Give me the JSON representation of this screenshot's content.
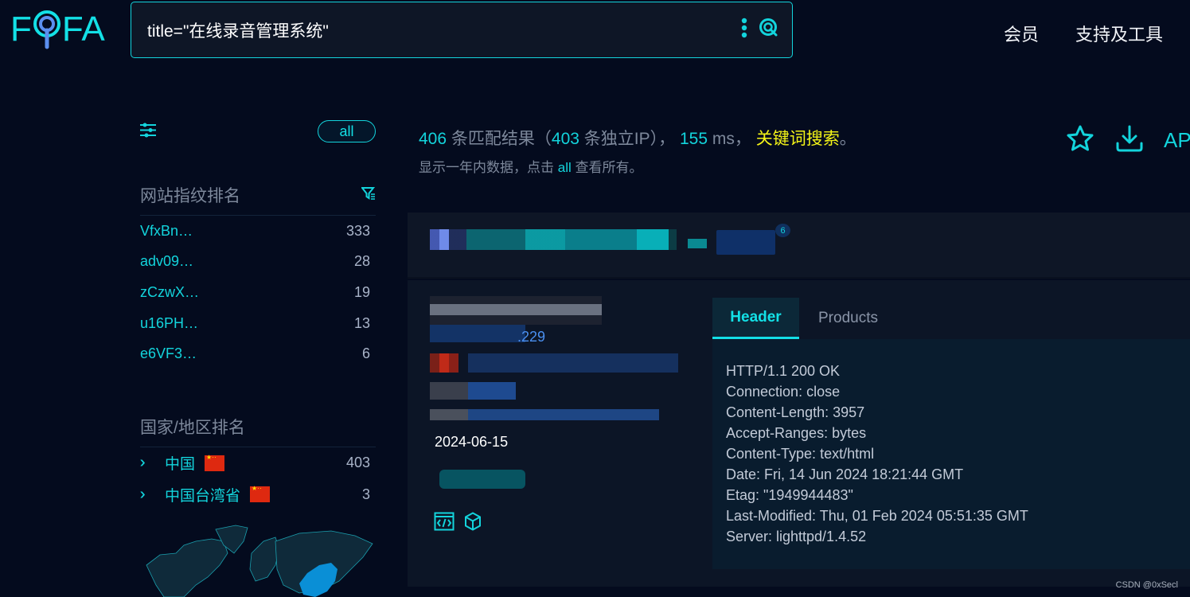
{
  "app": {
    "logo_text_left": "F",
    "logo_text_right": "FA",
    "brand_color": "#13e0e6",
    "keyword_color": "#f5f517"
  },
  "search": {
    "query": "title=\"在线录音管理系统\"",
    "more_icon": "vertical-dots-icon",
    "search_icon": "search-icon"
  },
  "nav": {
    "items": [
      {
        "label": "会员"
      },
      {
        "label": "支持及工具"
      }
    ]
  },
  "sidebar": {
    "settings_icon": "sliders-icon",
    "all_label": "all",
    "fingerprint_title": "网站指纹排名",
    "fingerprint_filter_icon": "filter-icon",
    "fingerprints": [
      {
        "name": "VfxBn…",
        "count": "333"
      },
      {
        "name": "adv09…",
        "count": "28"
      },
      {
        "name": "zCzwX…",
        "count": "19"
      },
      {
        "name": "u16PH…",
        "count": "13"
      },
      {
        "name": "e6VF3…",
        "count": "6"
      }
    ],
    "country_title": "国家/地区排名",
    "countries": [
      {
        "name": "中国",
        "count": "403",
        "flag": "cn-flag"
      },
      {
        "name": "中国台湾省",
        "count": "3",
        "flag": "cn-flag"
      }
    ],
    "map_highlight": "China"
  },
  "summary": {
    "total": "406",
    "total_label": "条匹配结果（",
    "unique_ip": "403",
    "unique_ip_label": "条独立IP），",
    "time": "155",
    "time_unit": "ms，",
    "keyword_search": "关键词搜索",
    "period": "。",
    "note_prefix": "显示一年内数据，点击",
    "note_link": "all",
    "note_suffix": "查看所有。"
  },
  "actions": {
    "star_icon": "star-icon",
    "download_icon": "download-icon",
    "api_label": "API"
  },
  "result": {
    "badge_count": "6",
    "ip_suffix": ".229",
    "date": "2024-06-15",
    "icons": [
      "code-window-icon",
      "cube-icon"
    ],
    "tabs": [
      {
        "label": "Header",
        "active": true
      },
      {
        "label": "Products",
        "active": false
      }
    ],
    "header_lines": [
      "HTTP/1.1 200 OK",
      "Connection: close",
      "Content-Length: 3957",
      "Accept-Ranges: bytes",
      "Content-Type: text/html",
      "Date: Fri, 14 Jun 2024 18:21:44 GMT",
      "Etag: \"1949944483\"",
      "Last-Modified: Thu, 01 Feb 2024 05:51:35 GMT",
      "Server: lighttpd/1.4.52"
    ]
  },
  "watermark": "CSDN @0xSecl"
}
